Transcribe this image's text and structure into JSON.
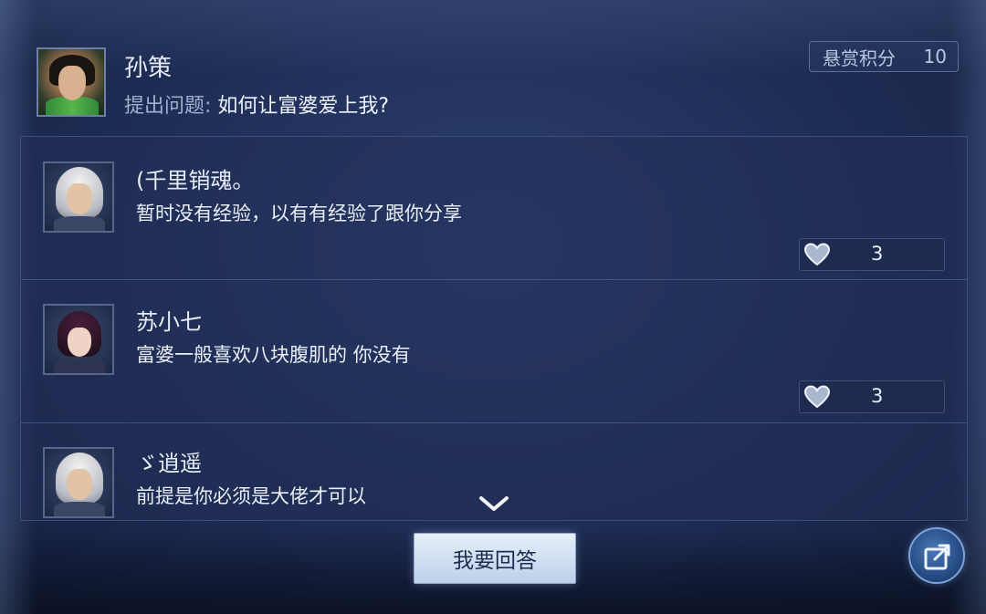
{
  "question": {
    "asker_name": "孙策",
    "label": "提出问题:",
    "text": "如何让富婆爱上我?"
  },
  "bounty": {
    "label": "悬赏积分",
    "value": "10"
  },
  "answers": [
    {
      "name": "(千里销魂。",
      "text": "暂时没有经验，以有有经验了跟你分享",
      "likes": "3",
      "avatar_icon": "white-hair-avatar"
    },
    {
      "name": "苏小七",
      "text": "富婆一般喜欢八块腹肌的 你没有",
      "likes": "3",
      "avatar_icon": "dark-hair-avatar"
    },
    {
      "name": "ゞ逍遥",
      "text": "前提是你必须是大佬才可以",
      "avatar_icon": "white-hair-avatar"
    }
  ],
  "actions": {
    "answer_label": "我要回答",
    "share_icon": "share-icon",
    "scroll_icon": "chevron-down-icon"
  },
  "colors": {
    "background": "#1e2d55",
    "button": "#d3e1f3",
    "text": "#e9eef8"
  }
}
